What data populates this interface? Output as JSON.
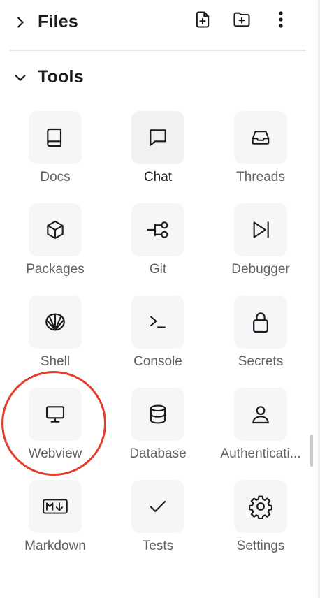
{
  "files": {
    "title": "Files",
    "new_file_icon": "file-plus-icon",
    "new_folder_icon": "folder-plus-icon",
    "more_icon": "more-vertical-icon"
  },
  "tools": {
    "title": "Tools",
    "items": [
      {
        "label": "Docs",
        "icon": "book-icon",
        "active": false
      },
      {
        "label": "Chat",
        "icon": "chat-icon",
        "active": true
      },
      {
        "label": "Threads",
        "icon": "inbox-icon",
        "active": false
      },
      {
        "label": "Packages",
        "icon": "box-icon",
        "active": false
      },
      {
        "label": "Git",
        "icon": "git-icon",
        "active": false
      },
      {
        "label": "Debugger",
        "icon": "debugger-icon",
        "active": false
      },
      {
        "label": "Shell",
        "icon": "shell-icon",
        "active": false
      },
      {
        "label": "Console",
        "icon": "terminal-icon",
        "active": false
      },
      {
        "label": "Secrets",
        "icon": "lock-icon",
        "active": false
      },
      {
        "label": "Webview",
        "icon": "monitor-icon",
        "active": false
      },
      {
        "label": "Database",
        "icon": "database-icon",
        "active": false
      },
      {
        "label": "Authenticati...",
        "icon": "user-icon",
        "active": false
      },
      {
        "label": "Markdown",
        "icon": "markdown-icon",
        "active": false
      },
      {
        "label": "Tests",
        "icon": "check-icon",
        "active": false
      },
      {
        "label": "Settings",
        "icon": "gear-icon",
        "active": false
      }
    ]
  },
  "colors": {
    "annotation_circle": "#e43d2b",
    "tile_background": "#f5f6f7",
    "label_text": "#5f6167"
  }
}
